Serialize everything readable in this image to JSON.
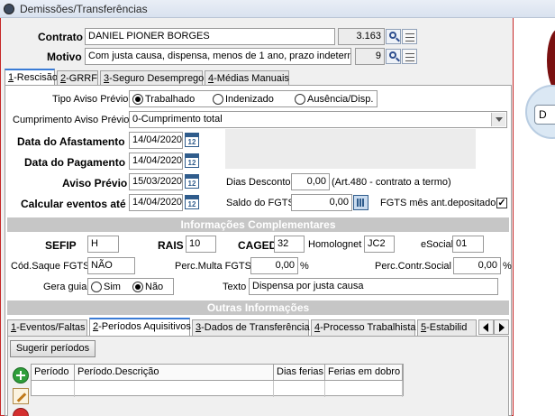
{
  "window": {
    "title": "Demissões/Transferências"
  },
  "header": {
    "contrato_label": "Contrato",
    "contrato_value": "DANIEL PIONER BORGES",
    "contrato_code": "3.163",
    "motivo_label": "Motivo",
    "motivo_value": "Com justa causa, dispensa, menos de 1 ano, prazo indetermi",
    "motivo_code": "9"
  },
  "tabs": [
    {
      "key": "1",
      "label": "-Rescisão"
    },
    {
      "key": "2",
      "label": "-GRRF"
    },
    {
      "key": "3",
      "label": "-Seguro Desemprego"
    },
    {
      "key": "4",
      "label": "-Médias Manuais"
    }
  ],
  "rescisao": {
    "tipo_aviso_label": "Tipo Aviso Prévio",
    "tipo_aviso_options": [
      "Trabalhado",
      "Indenizado",
      "Ausência/Disp."
    ],
    "cumprimento_label": "Cumprimento Aviso Prévio",
    "cumprimento_value": "0-Cumprimento total",
    "data_afastamento_label": "Data do Afastamento",
    "data_afastamento": "14/04/2020",
    "data_pagamento_label": "Data do Pagamento",
    "data_pagamento": "14/04/2020",
    "aviso_previo_label": "Aviso Prévio",
    "aviso_previo": "15/03/2020",
    "calcular_label": "Calcular eventos até",
    "calcular": "14/04/2020",
    "dias_desconto_label": "Dias Desconto",
    "dias_desconto": "0,00",
    "dias_desconto_note": "(Art.480 - contrato a termo)",
    "saldo_fgts_label": "Saldo do FGTS",
    "saldo_fgts": "0,00",
    "fgts_mes_label": "FGTS mês ant.depositado",
    "fgts_mes_check": "✓",
    "calendar_glyph": "12"
  },
  "complementares": {
    "title": "Informações Complementares",
    "sefip_label": "SEFIP",
    "sefip": "H",
    "rais_label": "RAIS",
    "rais": "10",
    "caged_label": "CAGED",
    "caged": "32",
    "homolognet_label": "Homolognet",
    "homolognet": "JC2",
    "esocial_label": "eSocial",
    "esocial": "01",
    "saque_label": "Cód.Saque FGTS",
    "saque": "NÃO",
    "multa_label": "Perc.Multa FGTS",
    "multa": "0,00",
    "multa_unit": "%",
    "contr_label": "Perc.Contr.Social",
    "contr": "0,00",
    "contr_unit": "%",
    "gera_guia_label": "Gera guia",
    "gera_guia_options": [
      "Sim",
      "Não"
    ],
    "texto_label": "Texto",
    "texto": "Dispensa por justa causa"
  },
  "outras": {
    "title": "Outras Informações",
    "tabs": [
      {
        "key": "1",
        "label": "-Eventos/Faltas"
      },
      {
        "key": "2",
        "label": "-Períodos Aquisitivos"
      },
      {
        "key": "3",
        "label": "-Dados de Transferência"
      },
      {
        "key": "4",
        "label": "-Processo Trabalhista"
      },
      {
        "key": "5",
        "label": "-Estabilid"
      }
    ],
    "sugerir_label": "Sugerir períodos",
    "columns": [
      "Período",
      "Período.Descrição",
      "Dias ferias",
      "Ferias em dobro"
    ]
  },
  "side": {
    "partial_label": "D"
  }
}
